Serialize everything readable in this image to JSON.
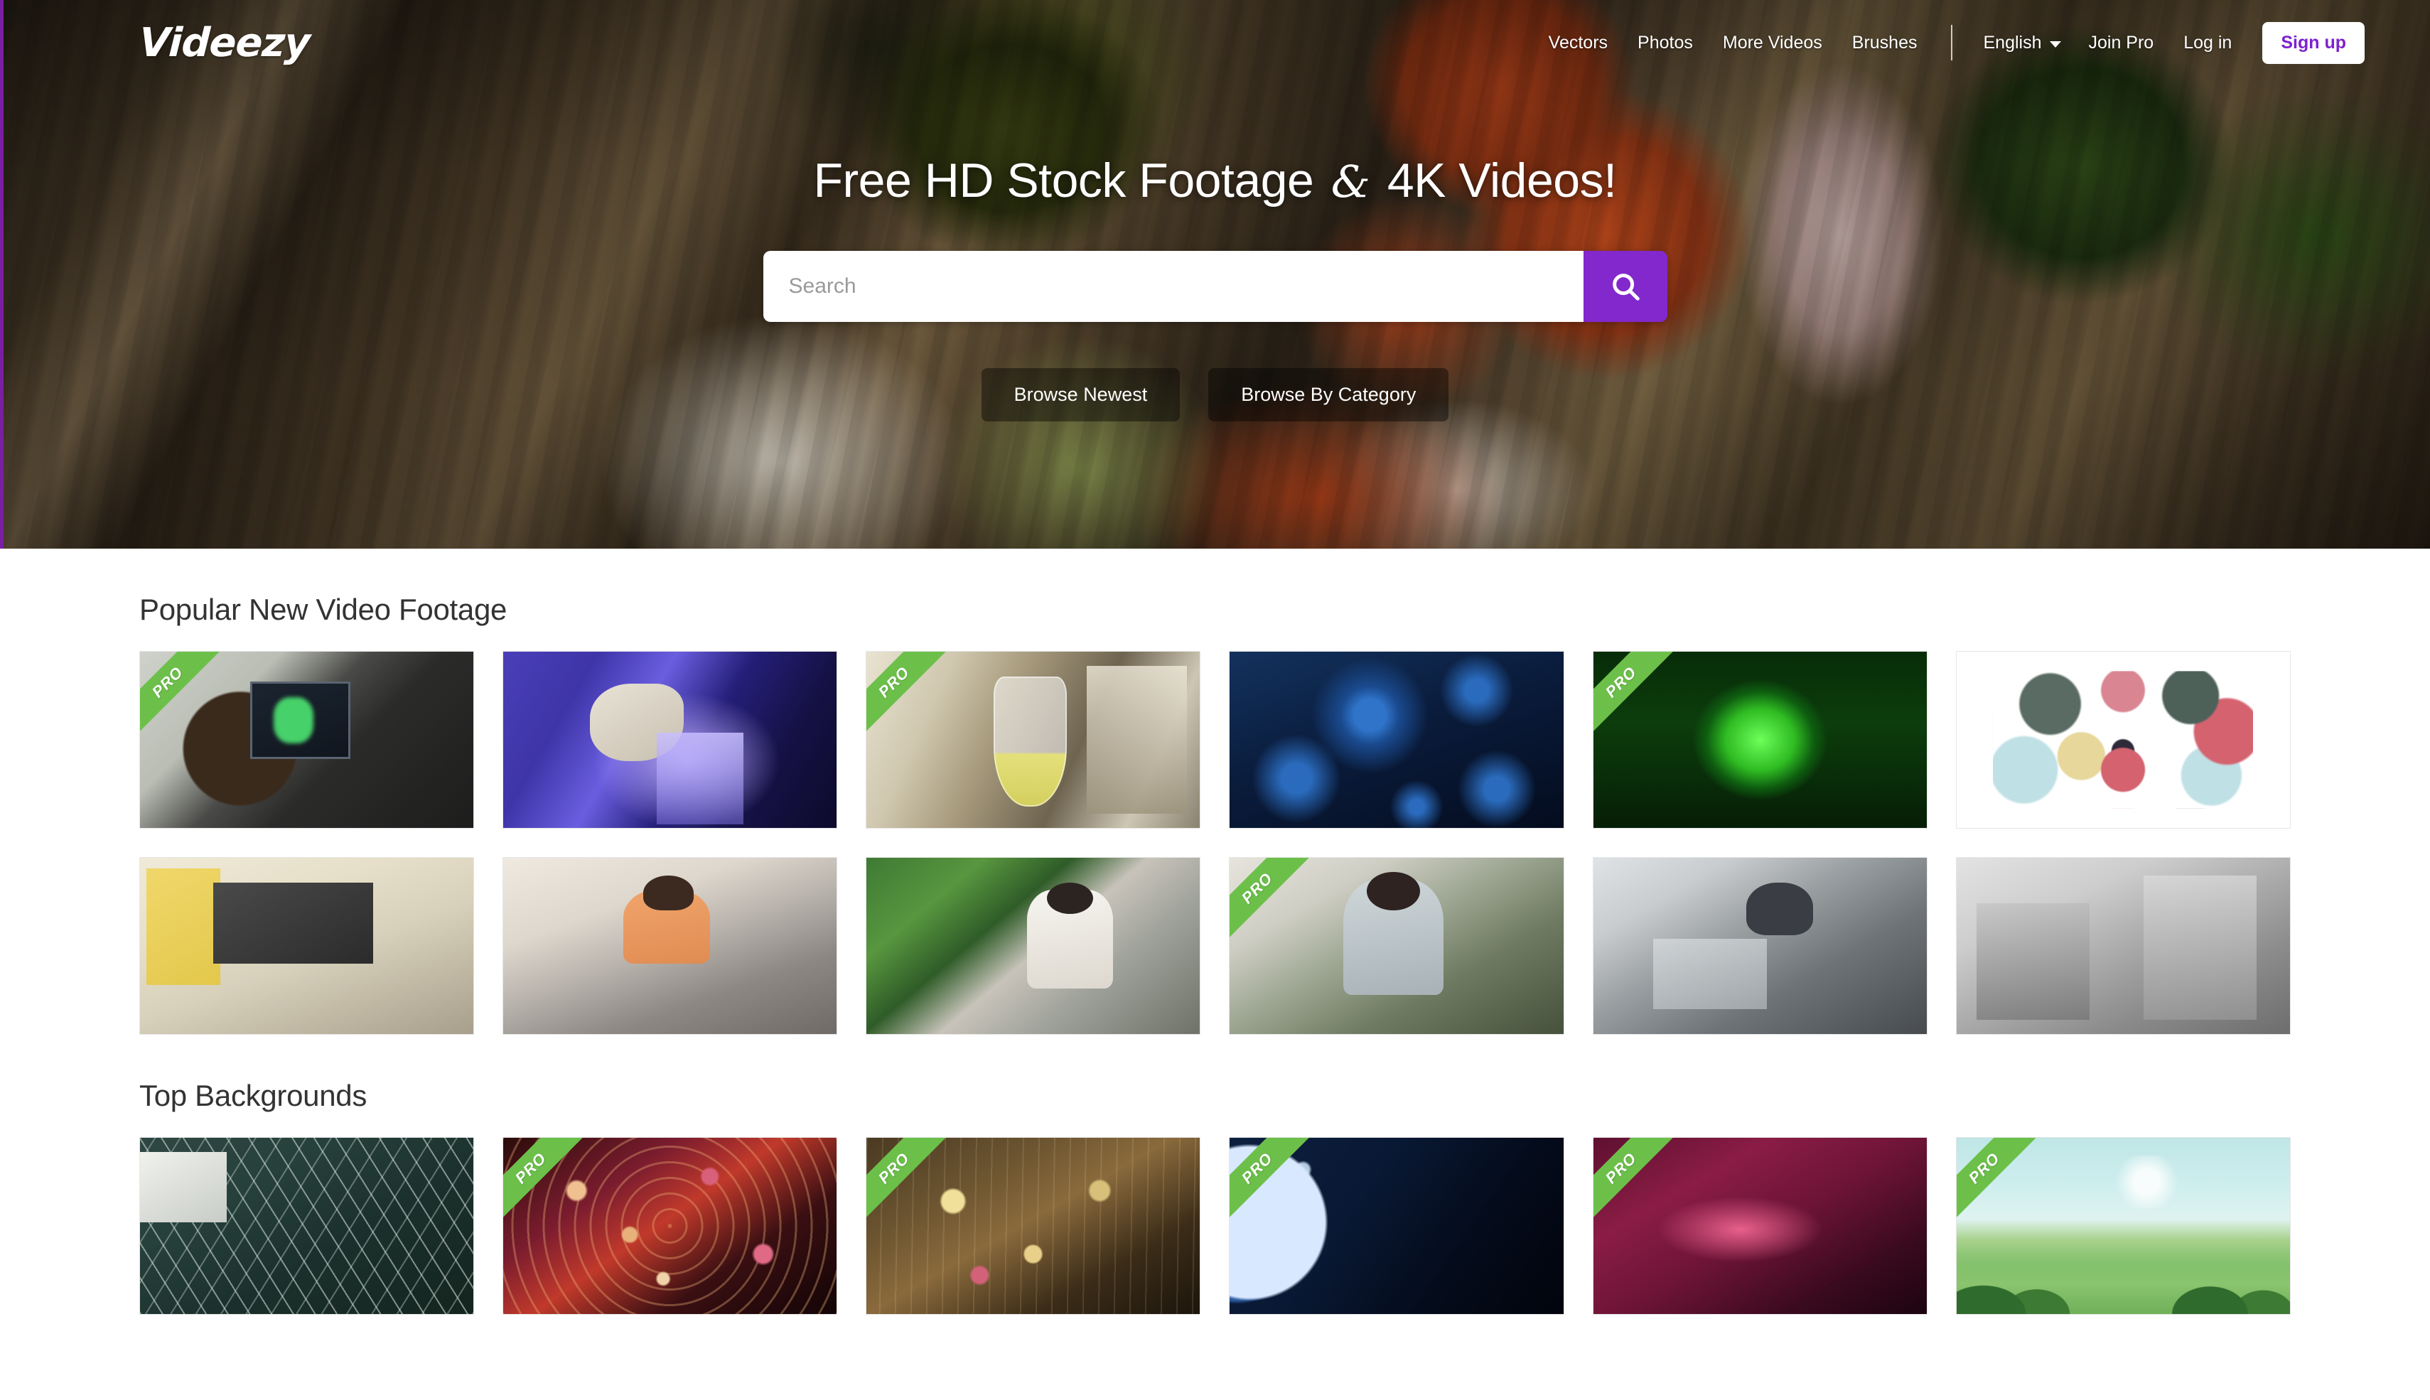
{
  "site": {
    "logo": "Videezy",
    "accent_purple": "#8228cd",
    "ribbon_green": "#6cc04a",
    "signup_text_color": "#7e22ce"
  },
  "header": {
    "nav_links": [
      {
        "label": "Vectors"
      },
      {
        "label": "Photos"
      },
      {
        "label": "More Videos"
      },
      {
        "label": "Brushes"
      }
    ],
    "language": {
      "label": "English",
      "icon": "chevron-down-icon"
    },
    "join_pro": "Join Pro",
    "log_in": "Log in",
    "sign_up": "Sign up"
  },
  "hero": {
    "title_before": "Free HD Stock Footage",
    "title_amp": "&",
    "title_after": "4K Videos!",
    "search": {
      "placeholder": "Search",
      "value": "",
      "button_icon": "search-icon"
    },
    "buttons": [
      {
        "label": "Browse Newest"
      },
      {
        "label": "Browse By Category"
      }
    ]
  },
  "sections": [
    {
      "title": "Popular New Video Footage",
      "items": [
        {
          "art": "t-micro",
          "pro": true,
          "badge": "PRO",
          "alt": "scientist-at-microscope"
        },
        {
          "art": "t-pipette",
          "pro": false,
          "badge": "PRO",
          "alt": "pipette-into-vials"
        },
        {
          "art": "t-flask",
          "pro": true,
          "badge": "PRO",
          "alt": "laboratory-flask"
        },
        {
          "art": "t-virus",
          "pro": false,
          "badge": "PRO",
          "alt": "blue-virus-cells"
        },
        {
          "art": "t-cell",
          "pro": true,
          "badge": "PRO",
          "alt": "green-glowing-cell"
        },
        {
          "art": "t-illus",
          "pro": false,
          "badge": "PRO",
          "alt": "ecommerce-illustration"
        },
        {
          "art": "t-laptop",
          "pro": false,
          "badge": "PRO",
          "alt": "hands-typing-on-laptop"
        },
        {
          "art": "t-couch",
          "pro": false,
          "badge": "PRO",
          "alt": "couple-on-couch-with-phone"
        },
        {
          "art": "t-cafe",
          "pro": false,
          "badge": "PRO",
          "alt": "woman-drinking-coffee-working"
        },
        {
          "art": "t-thumbsup",
          "pro": true,
          "badge": "PRO",
          "alt": "woman-in-mask-thumbs-up"
        },
        {
          "art": "t-tired",
          "pro": false,
          "badge": "PRO",
          "alt": "tired-man-at-desk"
        },
        {
          "art": "t-gray",
          "pro": false,
          "badge": "PRO",
          "alt": "grayscale-people-meeting"
        }
      ]
    },
    {
      "title": "Top Backgrounds",
      "items": [
        {
          "art": "t-geo",
          "pro": false,
          "badge": "PRO",
          "alt": "dark-geometric-lines"
        },
        {
          "art": "t-bokeh-red",
          "pro": true,
          "badge": "PRO",
          "alt": "red-gold-bokeh-tunnel"
        },
        {
          "art": "t-bokeh-gold",
          "pro": true,
          "badge": "PRO",
          "alt": "golden-bokeh-streaks"
        },
        {
          "art": "t-earth",
          "pro": true,
          "badge": "PRO",
          "alt": "earth-from-space-sunrise"
        },
        {
          "art": "t-poly",
          "pro": true,
          "badge": "PRO",
          "alt": "crimson-low-poly-shards"
        },
        {
          "art": "t-landscape",
          "pro": true,
          "badge": "PRO",
          "alt": "cartoon-green-landscape"
        }
      ]
    }
  ]
}
